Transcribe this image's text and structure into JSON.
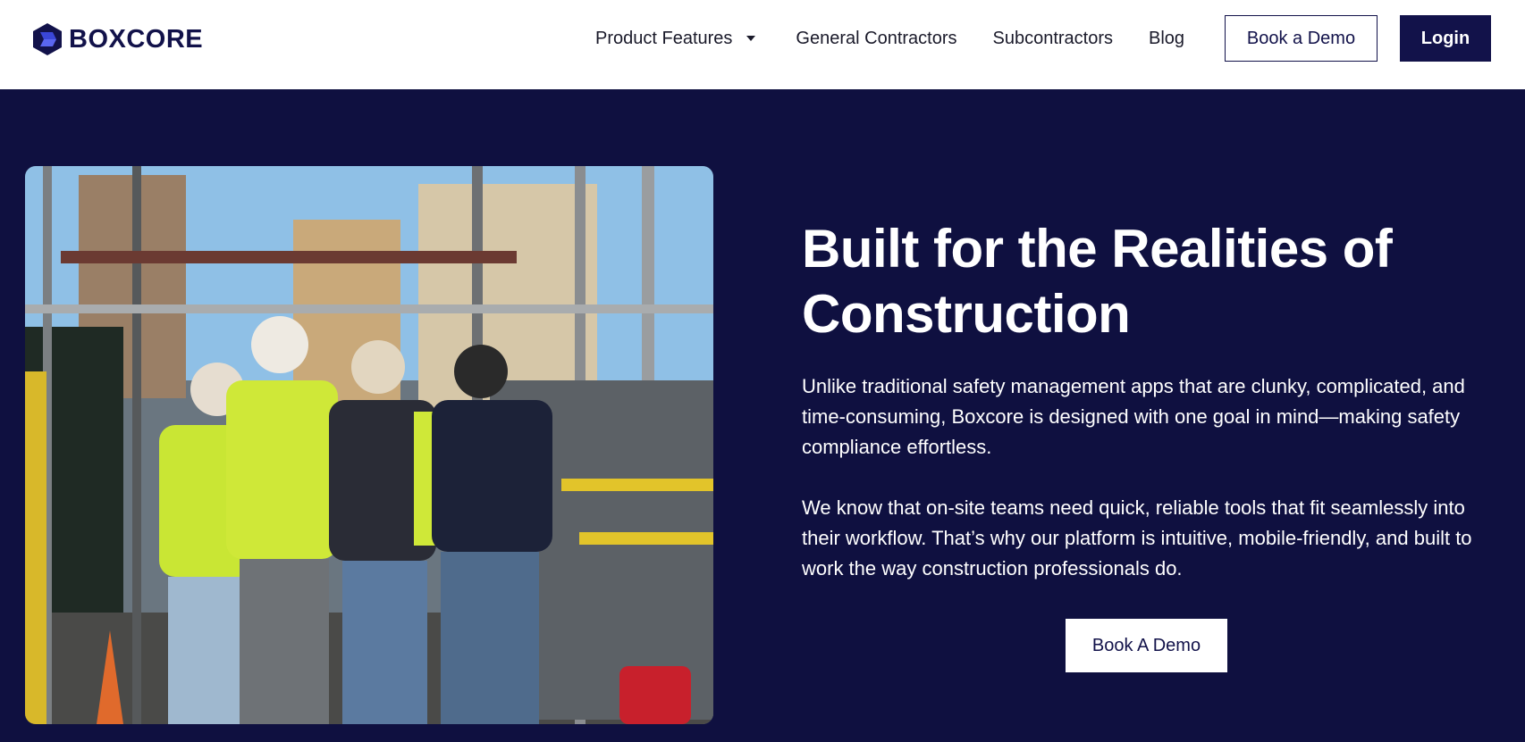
{
  "brand": {
    "name": "BOXCORE",
    "logo_icon": "hexagon-logo-icon",
    "primary_color": "#12124a",
    "accent_color": "#3a46d8"
  },
  "nav": {
    "items": [
      {
        "label": "Product Features",
        "has_dropdown": true,
        "icon": "caret-down-icon"
      },
      {
        "label": "General Contractors"
      },
      {
        "label": "Subcontractors"
      },
      {
        "label": "Blog"
      }
    ],
    "demo_label": "Book a Demo",
    "login_label": "Login"
  },
  "hero": {
    "background": "#0f1040",
    "title": "Built for the Realities of Construction",
    "paragraph_1": "Unlike traditional safety management apps that are clunky, complicated, and time-consuming, Boxcore is designed with one goal in mind—making safety compliance effortless.",
    "paragraph_2": "We know that on-site teams need quick, reliable tools that fit seamlessly into their workflow. That’s why our platform is intuitive, mobile-friendly, and built to work the way construction professionals do.",
    "cta_label": "Book A Demo"
  }
}
